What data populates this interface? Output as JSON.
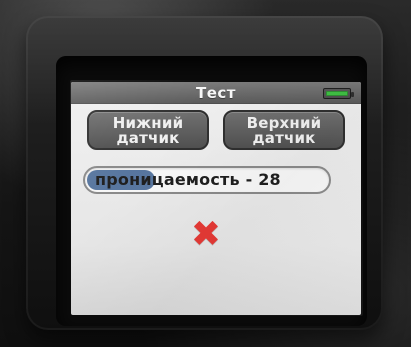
{
  "screen": {
    "title": "Тест",
    "battery": {
      "level": 0.9,
      "color": "#3fc044"
    },
    "buttons": {
      "lower_sensor_label": "Нижний\nдатчик",
      "upper_sensor_label": "Верхний\nдатчик"
    },
    "permeability": {
      "text": "проницаемость - 28",
      "progress": 0.28,
      "fill_color": "#4f6f9a"
    },
    "status": {
      "icon": "x-icon",
      "glyph": "✖",
      "color": "#e53935"
    }
  }
}
